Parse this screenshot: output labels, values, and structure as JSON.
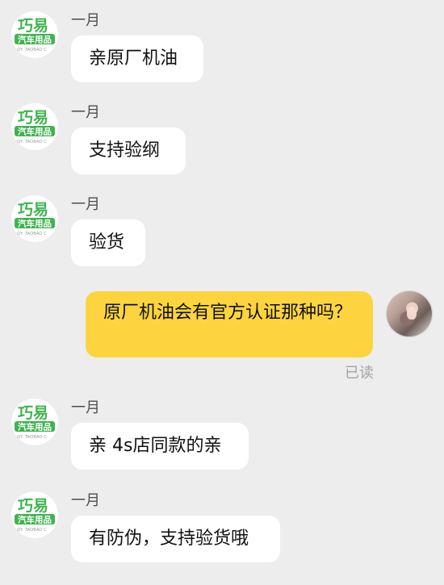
{
  "chat": {
    "messages": [
      {
        "sender": "shop",
        "time": "一月",
        "text": "亲原厂机油"
      },
      {
        "sender": "shop",
        "time": "一月",
        "text": "支持验纲"
      },
      {
        "sender": "shop",
        "time": "一月",
        "text": "验货"
      },
      {
        "sender": "me",
        "text": "原厂机油会有官方认证那种吗？",
        "status": "已读"
      },
      {
        "sender": "shop",
        "time": "一月",
        "text": "亲 4s店同款的亲"
      },
      {
        "sender": "shop",
        "time": "一月",
        "text": "有防伪，支持验货哦"
      }
    ]
  },
  "shop_avatar": {
    "logo_text": "巧易",
    "sub_text": "汽车用品",
    "tiny_text": "QY. TAOBAO C",
    "colors": {
      "primary": "#3fb34f",
      "secondary": "#2b9f3e",
      "text": "#ffffff"
    }
  },
  "icons": {
    "shop_avatar": "shop-logo-icon",
    "my_avatar": "user-photo-icon"
  }
}
